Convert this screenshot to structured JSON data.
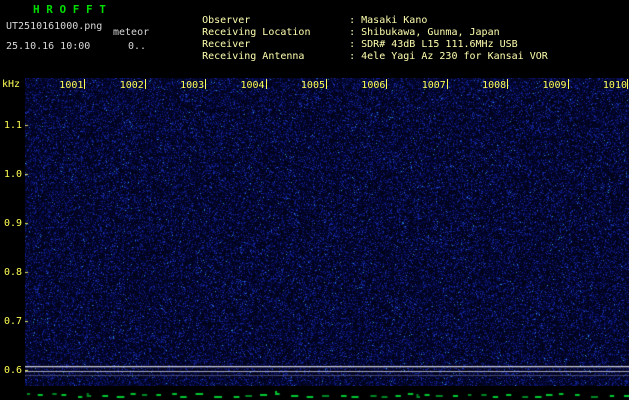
{
  "title": "H R O F F T",
  "file_info": {
    "filename": "UT2510161000.png",
    "tag": "meteor",
    "datetime": "25.10.16 10:00",
    "counter": "0.."
  },
  "header": {
    "rows": [
      {
        "label": "Observer",
        "value": ": Masaki Kano"
      },
      {
        "label": "Receiving Location",
        "value": ": Shibukawa, Gunma, Japan"
      },
      {
        "label": "Receiver",
        "value": ": SDR# 43dB L15 111.6MHz USB"
      },
      {
        "label": "Receiving Antenna",
        "value": ": 4ele Yagi Az 230 for Kansai VOR"
      }
    ]
  },
  "chart_data": {
    "type": "heatmap",
    "title": "HROFFT 10-minute meteor radio observation spectrogram",
    "ylabel": "kHz",
    "y_ticks": [
      "1.1",
      "1.0",
      "0.9",
      "0.8",
      "0.7",
      "0.6"
    ],
    "y_range_khz": [
      0.56,
      1.2
    ],
    "x_ticks": [
      "1001",
      "1002",
      "1003",
      "1004",
      "1005",
      "1006",
      "1007",
      "1008",
      "1009",
      "1010"
    ],
    "x_range_time_ut": [
      "10:00",
      "10:10"
    ],
    "features": [
      {
        "type": "carrier-line",
        "freq_khz": 0.61
      },
      {
        "type": "carrier-line",
        "freq_khz": 0.6
      },
      {
        "type": "background",
        "description": "uniform dark-blue receiver noise, no meteor echoes visible"
      }
    ],
    "level_strip": "flat dashed green signal-level trace along bottom edge",
    "grid": false,
    "legend": false
  },
  "colors": {
    "background": "#000000",
    "title_green": "#00dd00",
    "header_yellow": "#ffffb0",
    "file_white": "#d8d8d8",
    "axis_yellow": "#ffff55",
    "noise_base": "#000826",
    "carrier_gray": "#c8c8d0",
    "level_green": "#00c832"
  }
}
